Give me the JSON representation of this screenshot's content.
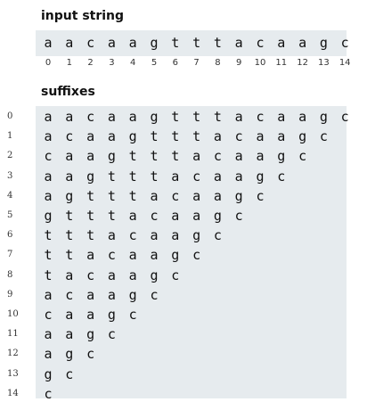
{
  "input_heading": "input string",
  "suffixes_heading": "suffixes",
  "input_chars": [
    "a",
    "a",
    "c",
    "a",
    "a",
    "g",
    "t",
    "t",
    "t",
    "a",
    "c",
    "a",
    "a",
    "g",
    "c"
  ],
  "indices": [
    "0",
    "1",
    "2",
    "3",
    "4",
    "5",
    "6",
    "7",
    "8",
    "9",
    "10",
    "11",
    "12",
    "13",
    "14"
  ],
  "suffixes": [
    {
      "label": "0",
      "chars": [
        "a",
        "a",
        "c",
        "a",
        "a",
        "g",
        "t",
        "t",
        "t",
        "a",
        "c",
        "a",
        "a",
        "g",
        "c"
      ]
    },
    {
      "label": "1",
      "chars": [
        "a",
        "c",
        "a",
        "a",
        "g",
        "t",
        "t",
        "t",
        "a",
        "c",
        "a",
        "a",
        "g",
        "c"
      ]
    },
    {
      "label": "2",
      "chars": [
        "c",
        "a",
        "a",
        "g",
        "t",
        "t",
        "t",
        "a",
        "c",
        "a",
        "a",
        "g",
        "c"
      ]
    },
    {
      "label": "3",
      "chars": [
        "a",
        "a",
        "g",
        "t",
        "t",
        "t",
        "a",
        "c",
        "a",
        "a",
        "g",
        "c"
      ]
    },
    {
      "label": "4",
      "chars": [
        "a",
        "g",
        "t",
        "t",
        "t",
        "a",
        "c",
        "a",
        "a",
        "g",
        "c"
      ]
    },
    {
      "label": "5",
      "chars": [
        "g",
        "t",
        "t",
        "t",
        "a",
        "c",
        "a",
        "a",
        "g",
        "c"
      ]
    },
    {
      "label": "6",
      "chars": [
        "t",
        "t",
        "t",
        "a",
        "c",
        "a",
        "a",
        "g",
        "c"
      ]
    },
    {
      "label": "7",
      "chars": [
        "t",
        "t",
        "a",
        "c",
        "a",
        "a",
        "g",
        "c"
      ]
    },
    {
      "label": "8",
      "chars": [
        "t",
        "a",
        "c",
        "a",
        "a",
        "g",
        "c"
      ]
    },
    {
      "label": "9",
      "chars": [
        "a",
        "c",
        "a",
        "a",
        "g",
        "c"
      ]
    },
    {
      "label": "10",
      "chars": [
        "c",
        "a",
        "a",
        "g",
        "c"
      ]
    },
    {
      "label": "11",
      "chars": [
        "a",
        "a",
        "g",
        "c"
      ]
    },
    {
      "label": "12",
      "chars": [
        "a",
        "g",
        "c"
      ]
    },
    {
      "label": "13",
      "chars": [
        "g",
        "c"
      ]
    },
    {
      "label": "14",
      "chars": [
        "c"
      ]
    }
  ]
}
